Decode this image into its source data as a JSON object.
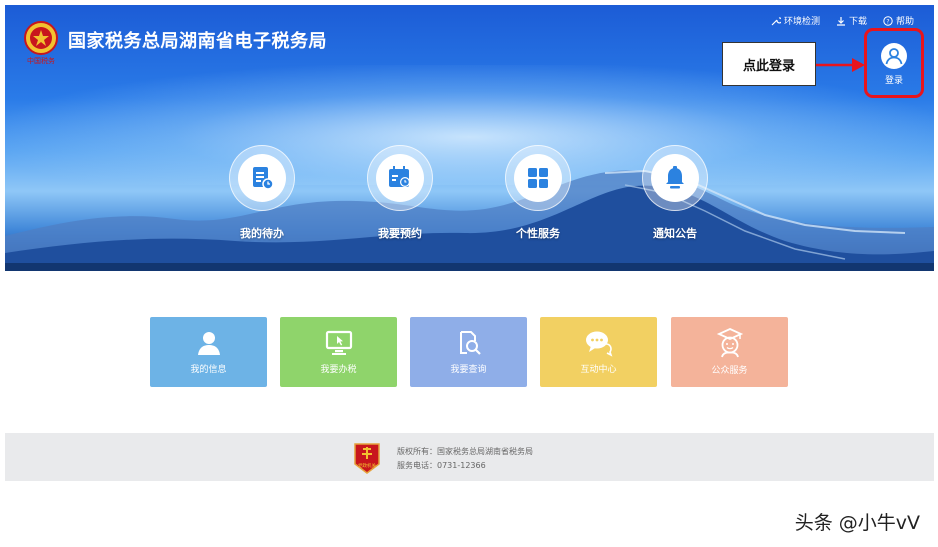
{
  "header": {
    "title": "国家税务总局湖南省电子税务局",
    "logo_text": "中国税务",
    "links": [
      {
        "icon": "tool-icon",
        "label": "环境检测"
      },
      {
        "icon": "download-icon",
        "label": "下载"
      },
      {
        "icon": "help-icon",
        "label": "帮助"
      }
    ],
    "login_label": "登录"
  },
  "annotation": {
    "callout_text": "点此登录",
    "color": "#e8141c"
  },
  "quick_menu": [
    {
      "icon": "todo-list-icon",
      "label": "我的待办"
    },
    {
      "icon": "calendar-booking-icon",
      "label": "我要预约"
    },
    {
      "icon": "grid-services-icon",
      "label": "个性服务"
    },
    {
      "icon": "bell-icon",
      "label": "通知公告"
    }
  ],
  "tiles": [
    {
      "icon": "user-icon",
      "label": "我的信息",
      "color": "#6db3e6"
    },
    {
      "icon": "monitor-icon",
      "label": "我要办税",
      "color": "#8fd46b"
    },
    {
      "icon": "search-document-icon",
      "label": "我要查询",
      "color": "#8faee8"
    },
    {
      "icon": "chat-icon",
      "label": "互动中心",
      "color": "#f2d062"
    },
    {
      "icon": "public-service-icon",
      "label": "公众服务",
      "color": "#f4b39a"
    }
  ],
  "footer": {
    "copyright": "版权所有：国家税务总局湖南省税务局",
    "phone": "服务电话：0731-12366",
    "emblem_text": "党政机关"
  },
  "watermark": "头条 @小牛vV",
  "colors": {
    "banner_blue": "#2a7be8",
    "footer_bg": "#e9eaec"
  }
}
